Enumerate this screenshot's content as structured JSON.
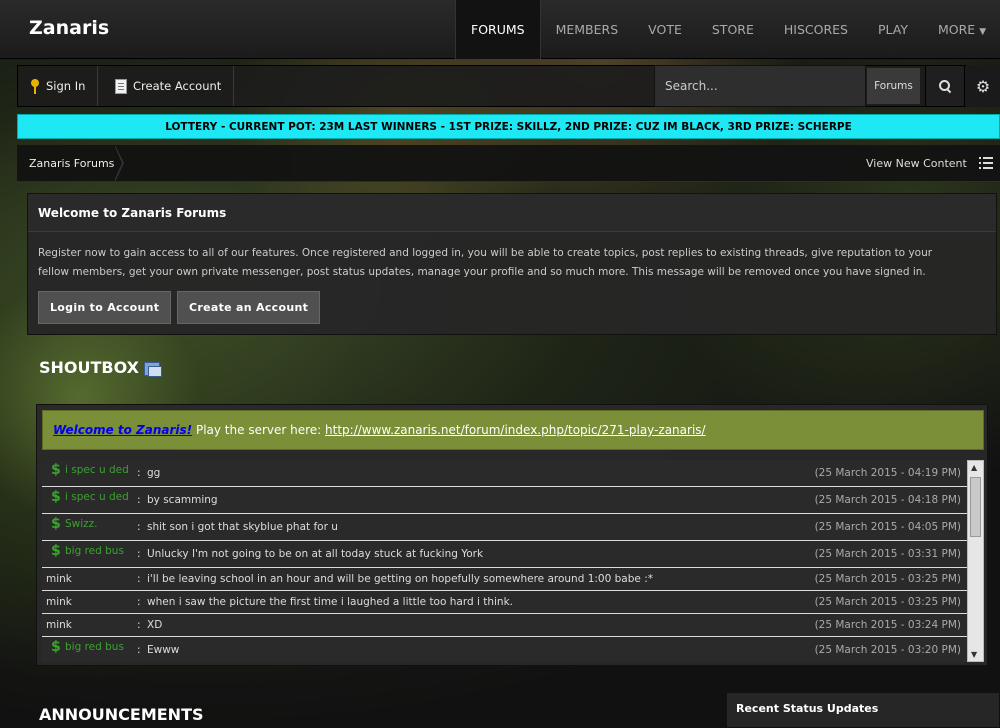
{
  "brand": "Zanaris",
  "nav": {
    "items": [
      "FORUMS",
      "MEMBERS",
      "VOTE",
      "STORE",
      "HISCORES",
      "PLAY",
      "MORE"
    ],
    "active": "FORUMS"
  },
  "userbar": {
    "sign_in": "Sign In",
    "create_account": "Create Account",
    "search_placeholder": "Search...",
    "search_scope": "Forums"
  },
  "lottery": "LOTTERY - CURRENT POT: 23M LAST WINNERS - 1ST PRIZE: SKILLZ, 2ND PRIZE: CUZ IM BLACK, 3RD PRIZE: SCHERPE",
  "breadcrumb": {
    "root": "Zanaris Forums",
    "view_new": "View New Content"
  },
  "welcome": {
    "title": "Welcome to Zanaris Forums",
    "body": "Register now to gain access to all of our features. Once registered and logged in, you will be able to create topics, post replies to existing threads, give reputation to your fellow members, get your own private messenger, post status updates, manage your profile and so much more. This message will be removed once you have signed in.",
    "login_button": "Login to Account",
    "create_button": "Create an Account"
  },
  "shoutbox": {
    "title": "SHOUTBOX",
    "banner_welcome": "Welcome to Zanaris!",
    "banner_text": " Play the server here: ",
    "banner_link": "http://www.zanaris.net/forum/index.php/topic/271-play-zanaris/",
    "rows": [
      {
        "user": "i spec u ded",
        "donor": true,
        "msg": "gg",
        "time": "(25 March 2015 - 04:19 PM)"
      },
      {
        "user": "i spec u ded",
        "donor": true,
        "msg": "by scamming",
        "time": "(25 March 2015 - 04:18 PM)"
      },
      {
        "user": "Swizz.",
        "donor": true,
        "msg": "shit son i got that skyblue phat for u",
        "time": "(25 March 2015 - 04:05 PM)"
      },
      {
        "user": "big red bus",
        "donor": true,
        "msg": "Unlucky I'm not going to be on at all today stuck at fucking York",
        "time": "(25 March 2015 - 03:31 PM)"
      },
      {
        "user": "mink",
        "donor": false,
        "msg": "i'll be leaving school in an hour and will be getting on hopefully somewhere around 1:00 babe :*",
        "time": "(25 March 2015 - 03:25 PM)"
      },
      {
        "user": "mink",
        "donor": false,
        "msg": "when i saw the picture the first time i laughed a little too hard i think.",
        "time": "(25 March 2015 - 03:25 PM)"
      },
      {
        "user": "mink",
        "donor": false,
        "msg": "XD",
        "time": "(25 March 2015 - 03:24 PM)"
      },
      {
        "user": "big red bus",
        "donor": true,
        "msg": "Ewww",
        "time": "(25 March 2015 - 03:20 PM)"
      }
    ]
  },
  "announcements_title": "ANNOUNCEMENTS",
  "recent_status_title": "Recent Status Updates"
}
